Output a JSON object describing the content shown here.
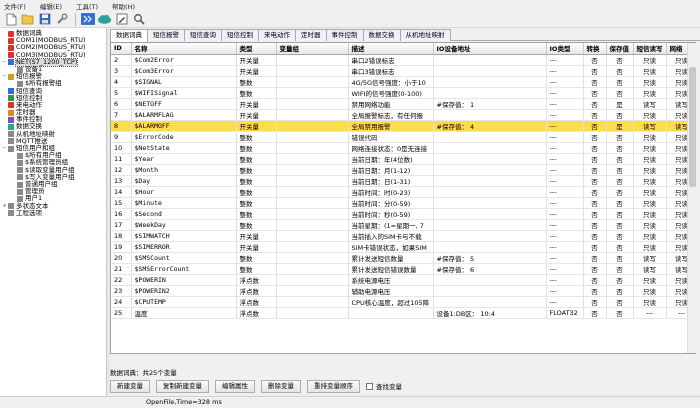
{
  "menu": [
    "文件(F)",
    "编辑(E)",
    "工具(T)",
    "帮助(H)"
  ],
  "toolbar": [
    "new-icon",
    "open-icon",
    "save-icon",
    "wrench-icon",
    "download-icon",
    "cloud-sync-icon",
    "edit-icon",
    "search-icon"
  ],
  "tree": [
    {
      "label": "数据词典",
      "level": 0,
      "icon": "red"
    },
    {
      "label": "COM1(MODBUS_RTU)",
      "level": 0,
      "icon": "red"
    },
    {
      "label": "COM2(MODBUS_RTU)",
      "level": 0,
      "icon": "red"
    },
    {
      "label": "COM3(MODBUS_RTU)",
      "level": 0,
      "icon": "red"
    },
    {
      "label": "NET(S7_1200_TCP)",
      "level": 0,
      "icon": "blue",
      "expander": "−",
      "selected": true
    },
    {
      "label": "设备1",
      "level": 1,
      "icon": "gray"
    },
    {
      "label": "短信报警",
      "level": 0,
      "icon": "bell",
      "expander": "−"
    },
    {
      "label": "$所有报警组",
      "level": 1,
      "icon": "gray"
    },
    {
      "label": "短信查询",
      "level": 0,
      "icon": "blue"
    },
    {
      "label": "短信控制",
      "level": 0,
      "icon": "green"
    },
    {
      "label": "来电动作",
      "level": 0,
      "icon": "red"
    },
    {
      "label": "定时器",
      "level": 0,
      "icon": "orange"
    },
    {
      "label": "事件控制",
      "level": 0,
      "icon": "purple"
    },
    {
      "label": "数据交换",
      "level": 0,
      "icon": "teal"
    },
    {
      "label": "从机地址映射",
      "level": 0,
      "icon": "gray"
    },
    {
      "label": "MQTT推送",
      "level": 0,
      "icon": "gray"
    },
    {
      "label": "短信用户和组",
      "level": 0,
      "icon": "gray",
      "expander": "−"
    },
    {
      "label": "$所有用户组",
      "level": 1,
      "icon": "gray"
    },
    {
      "label": "$系统管理员组",
      "level": 1,
      "icon": "gray"
    },
    {
      "label": "$读取变量用户组",
      "level": 1,
      "icon": "gray"
    },
    {
      "label": "$写入变量用户组",
      "level": 1,
      "icon": "gray"
    },
    {
      "label": "普通用户组",
      "level": 1,
      "icon": "gray"
    },
    {
      "label": "管理员",
      "level": 1,
      "icon": "gray"
    },
    {
      "label": "用户1",
      "level": 1,
      "icon": "gray"
    },
    {
      "label": "多状态文本",
      "level": 0,
      "icon": "gray",
      "expander": "+"
    },
    {
      "label": "工程选项",
      "level": 0,
      "icon": "gray"
    }
  ],
  "tabs": [
    "数据词典",
    "短信报警",
    "短信查询",
    "短信控制",
    "来电动作",
    "定时器",
    "事件控制",
    "数据交换",
    "从机地址映射"
  ],
  "active_tab": 0,
  "columns": [
    "ID",
    "名称",
    "类型",
    "变量组",
    "描述",
    "IO设备地址",
    "IO类型",
    "转换",
    "保存值",
    "短信读写",
    "网络"
  ],
  "rows": [
    [
      "2",
      "$Com2Error",
      "开关量",
      "",
      "串口2错误标志",
      "",
      "---",
      "否",
      "否",
      "只读",
      "只读"
    ],
    [
      "3",
      "$Com3Error",
      "开关量",
      "",
      "串口3错误标志",
      "",
      "---",
      "否",
      "否",
      "只读",
      "只读"
    ],
    [
      "4",
      "$SIGNAL",
      "整数",
      "",
      "4G/5G信号强度：小于10",
      "",
      "---",
      "否",
      "否",
      "只读",
      "只读"
    ],
    [
      "5",
      "$WIFISignal",
      "整数",
      "",
      "WIFI的信号强度(0-100)",
      "",
      "---",
      "否",
      "否",
      "只读",
      "只读"
    ],
    [
      "6",
      "$NETOFF",
      "开关量",
      "",
      "禁用网络功能",
      "#保存值： 1",
      "---",
      "否",
      "是",
      "读写",
      "读写"
    ],
    [
      "7",
      "$ALARMFLAG",
      "开关量",
      "",
      "全局报警标志，有任何报",
      "",
      "---",
      "否",
      "否",
      "只读",
      "只读"
    ],
    [
      "8",
      "$ALARMOFF",
      "开关量",
      "",
      "全局禁用报警",
      "#保存值： 4",
      "---",
      "否",
      "是",
      "读写",
      "读写"
    ],
    [
      "9",
      "$ErrorCode",
      "整数",
      "",
      "错误代码",
      "",
      "---",
      "否",
      "否",
      "只读",
      "只读"
    ],
    [
      "10",
      "$NetState",
      "整数",
      "",
      "网络连接状态：0是无连接",
      "",
      "---",
      "否",
      "否",
      "只读",
      "只读"
    ],
    [
      "11",
      "$Year",
      "整数",
      "",
      "当前日期：年(4位数)",
      "",
      "---",
      "否",
      "否",
      "只读",
      "只读"
    ],
    [
      "12",
      "$Month",
      "整数",
      "",
      "当前日期：月(1-12)",
      "",
      "---",
      "否",
      "否",
      "只读",
      "只读"
    ],
    [
      "13",
      "$Day",
      "整数",
      "",
      "当前日期：日(1-31)",
      "",
      "---",
      "否",
      "否",
      "只读",
      "只读"
    ],
    [
      "14",
      "$Hour",
      "整数",
      "",
      "当前时间：时(0-23)",
      "",
      "---",
      "否",
      "否",
      "只读",
      "只读"
    ],
    [
      "15",
      "$Minute",
      "整数",
      "",
      "当前时间：分(0-59)",
      "",
      "---",
      "否",
      "否",
      "只读",
      "只读"
    ],
    [
      "16",
      "$Second",
      "整数",
      "",
      "当前时间：秒(0-59)",
      "",
      "---",
      "否",
      "否",
      "只读",
      "只读"
    ],
    [
      "17",
      "$WeekDay",
      "整数",
      "",
      "当前星期：(1=星期一, 7",
      "",
      "---",
      "否",
      "否",
      "只读",
      "只读"
    ],
    [
      "18",
      "$SIMWATCH",
      "开关量",
      "",
      "当前插入的SIM卡与不载",
      "",
      "---",
      "否",
      "否",
      "只读",
      "只读"
    ],
    [
      "19",
      "$SIMERROR",
      "开关量",
      "",
      "SIM卡错误状态，如果SIM",
      "",
      "---",
      "否",
      "否",
      "只读",
      "只读"
    ],
    [
      "20",
      "$SMSCount",
      "整数",
      "",
      "累计发送短信数量",
      "#保存值： 5",
      "---",
      "否",
      "否",
      "读写",
      "读写"
    ],
    [
      "21",
      "$SMSErrorCount",
      "整数",
      "",
      "累计发送短信错误数量",
      "#保存值： 6",
      "---",
      "否",
      "否",
      "读写",
      "读写"
    ],
    [
      "22",
      "$POWERIN",
      "浮点数",
      "",
      "系统电源电压",
      "",
      "---",
      "否",
      "否",
      "只读",
      "只读"
    ],
    [
      "23",
      "$POWERIN2",
      "浮点数",
      "",
      "辅助电源电压",
      "",
      "---",
      "否",
      "否",
      "只读",
      "只读"
    ],
    [
      "24",
      "$CPUTEMP",
      "浮点数",
      "",
      "CPU核心温度，超过105降",
      "",
      "---",
      "否",
      "否",
      "只读",
      "只读"
    ],
    [
      "25",
      "温度",
      "浮点数",
      "",
      "",
      "设备1:DB区：  10:4",
      "FLOAT32",
      "否",
      "否",
      "---",
      "---"
    ]
  ],
  "selected_row": 6,
  "status_count": "数据词典：共25个变量",
  "buttons": [
    "新建变量",
    "复制新建变量",
    "编辑属性",
    "删除变量",
    "重排变量顺序"
  ],
  "search_checkbox": "查找变量",
  "statusbar": "OpenFile,Time=328 ms"
}
